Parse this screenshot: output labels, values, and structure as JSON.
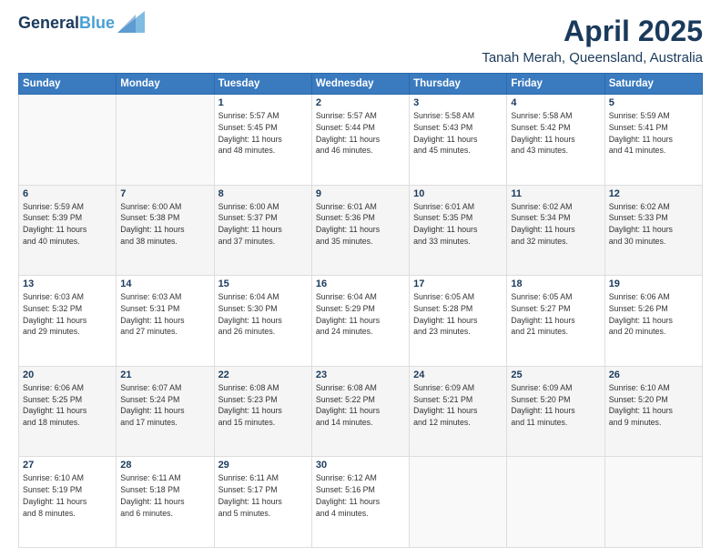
{
  "header": {
    "logo_line1": "General",
    "logo_line2": "Blue",
    "title": "April 2025",
    "subtitle": "Tanah Merah, Queensland, Australia"
  },
  "weekdays": [
    "Sunday",
    "Monday",
    "Tuesday",
    "Wednesday",
    "Thursday",
    "Friday",
    "Saturday"
  ],
  "weeks": [
    [
      {
        "day": "",
        "info": ""
      },
      {
        "day": "",
        "info": ""
      },
      {
        "day": "1",
        "info": "Sunrise: 5:57 AM\nSunset: 5:45 PM\nDaylight: 11 hours\nand 48 minutes."
      },
      {
        "day": "2",
        "info": "Sunrise: 5:57 AM\nSunset: 5:44 PM\nDaylight: 11 hours\nand 46 minutes."
      },
      {
        "day": "3",
        "info": "Sunrise: 5:58 AM\nSunset: 5:43 PM\nDaylight: 11 hours\nand 45 minutes."
      },
      {
        "day": "4",
        "info": "Sunrise: 5:58 AM\nSunset: 5:42 PM\nDaylight: 11 hours\nand 43 minutes."
      },
      {
        "day": "5",
        "info": "Sunrise: 5:59 AM\nSunset: 5:41 PM\nDaylight: 11 hours\nand 41 minutes."
      }
    ],
    [
      {
        "day": "6",
        "info": "Sunrise: 5:59 AM\nSunset: 5:39 PM\nDaylight: 11 hours\nand 40 minutes."
      },
      {
        "day": "7",
        "info": "Sunrise: 6:00 AM\nSunset: 5:38 PM\nDaylight: 11 hours\nand 38 minutes."
      },
      {
        "day": "8",
        "info": "Sunrise: 6:00 AM\nSunset: 5:37 PM\nDaylight: 11 hours\nand 37 minutes."
      },
      {
        "day": "9",
        "info": "Sunrise: 6:01 AM\nSunset: 5:36 PM\nDaylight: 11 hours\nand 35 minutes."
      },
      {
        "day": "10",
        "info": "Sunrise: 6:01 AM\nSunset: 5:35 PM\nDaylight: 11 hours\nand 33 minutes."
      },
      {
        "day": "11",
        "info": "Sunrise: 6:02 AM\nSunset: 5:34 PM\nDaylight: 11 hours\nand 32 minutes."
      },
      {
        "day": "12",
        "info": "Sunrise: 6:02 AM\nSunset: 5:33 PM\nDaylight: 11 hours\nand 30 minutes."
      }
    ],
    [
      {
        "day": "13",
        "info": "Sunrise: 6:03 AM\nSunset: 5:32 PM\nDaylight: 11 hours\nand 29 minutes."
      },
      {
        "day": "14",
        "info": "Sunrise: 6:03 AM\nSunset: 5:31 PM\nDaylight: 11 hours\nand 27 minutes."
      },
      {
        "day": "15",
        "info": "Sunrise: 6:04 AM\nSunset: 5:30 PM\nDaylight: 11 hours\nand 26 minutes."
      },
      {
        "day": "16",
        "info": "Sunrise: 6:04 AM\nSunset: 5:29 PM\nDaylight: 11 hours\nand 24 minutes."
      },
      {
        "day": "17",
        "info": "Sunrise: 6:05 AM\nSunset: 5:28 PM\nDaylight: 11 hours\nand 23 minutes."
      },
      {
        "day": "18",
        "info": "Sunrise: 6:05 AM\nSunset: 5:27 PM\nDaylight: 11 hours\nand 21 minutes."
      },
      {
        "day": "19",
        "info": "Sunrise: 6:06 AM\nSunset: 5:26 PM\nDaylight: 11 hours\nand 20 minutes."
      }
    ],
    [
      {
        "day": "20",
        "info": "Sunrise: 6:06 AM\nSunset: 5:25 PM\nDaylight: 11 hours\nand 18 minutes."
      },
      {
        "day": "21",
        "info": "Sunrise: 6:07 AM\nSunset: 5:24 PM\nDaylight: 11 hours\nand 17 minutes."
      },
      {
        "day": "22",
        "info": "Sunrise: 6:08 AM\nSunset: 5:23 PM\nDaylight: 11 hours\nand 15 minutes."
      },
      {
        "day": "23",
        "info": "Sunrise: 6:08 AM\nSunset: 5:22 PM\nDaylight: 11 hours\nand 14 minutes."
      },
      {
        "day": "24",
        "info": "Sunrise: 6:09 AM\nSunset: 5:21 PM\nDaylight: 11 hours\nand 12 minutes."
      },
      {
        "day": "25",
        "info": "Sunrise: 6:09 AM\nSunset: 5:20 PM\nDaylight: 11 hours\nand 11 minutes."
      },
      {
        "day": "26",
        "info": "Sunrise: 6:10 AM\nSunset: 5:20 PM\nDaylight: 11 hours\nand 9 minutes."
      }
    ],
    [
      {
        "day": "27",
        "info": "Sunrise: 6:10 AM\nSunset: 5:19 PM\nDaylight: 11 hours\nand 8 minutes."
      },
      {
        "day": "28",
        "info": "Sunrise: 6:11 AM\nSunset: 5:18 PM\nDaylight: 11 hours\nand 6 minutes."
      },
      {
        "day": "29",
        "info": "Sunrise: 6:11 AM\nSunset: 5:17 PM\nDaylight: 11 hours\nand 5 minutes."
      },
      {
        "day": "30",
        "info": "Sunrise: 6:12 AM\nSunset: 5:16 PM\nDaylight: 11 hours\nand 4 minutes."
      },
      {
        "day": "",
        "info": ""
      },
      {
        "day": "",
        "info": ""
      },
      {
        "day": "",
        "info": ""
      }
    ]
  ]
}
